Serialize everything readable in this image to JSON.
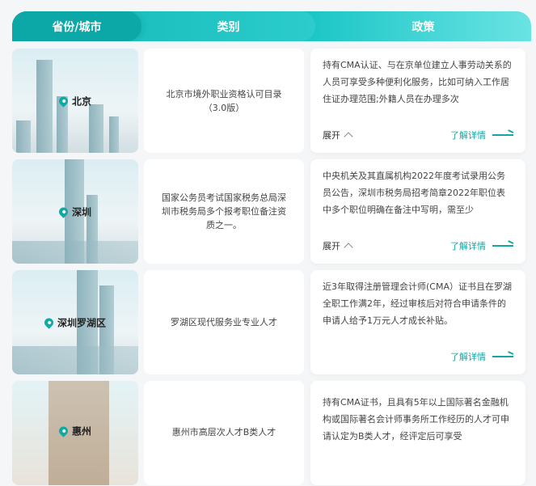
{
  "header": {
    "col1": "省份/城市",
    "col2": "类别",
    "col3": "政策"
  },
  "rows": [
    {
      "city": "北京",
      "category": "北京市境外职业资格认可目录（3.0版）",
      "policy": "持有CMA认证、与在京单位建立人事劳动关系的人员可享受多种便利化服务，比如可纳入工作居住证办理范围;外籍人员在办理多次",
      "expand": "展开",
      "more": "了解详情"
    },
    {
      "city": "深圳",
      "category": "国家公务员考试国家税务总局深圳市税务局多个报考职位备注资质之一。",
      "policy": "中央机关及其直属机构2022年度考试录用公务员公告，深圳市税务局招考简章2022年职位表中多个职位明确在备注中写明，需至少",
      "expand": "展开",
      "more": "了解详情"
    },
    {
      "city": "深圳罗湖区",
      "category": "罗湖区现代服务业专业人才",
      "policy": "近3年取得注册管理会计师(CMA）证书且在罗湖全职工作满2年，经过审核后对符合申请条件的申请人给予1万元人才成长补贴。",
      "more": "了解详情"
    },
    {
      "city": "惠州",
      "category": "惠州市高层次人才B类人才",
      "policy": "持有CMA证书，且具有5年以上国际著名金融机构或国际著名会计师事务所工作经历的人才可申请认定为B类人才，经评定后可享受"
    }
  ]
}
